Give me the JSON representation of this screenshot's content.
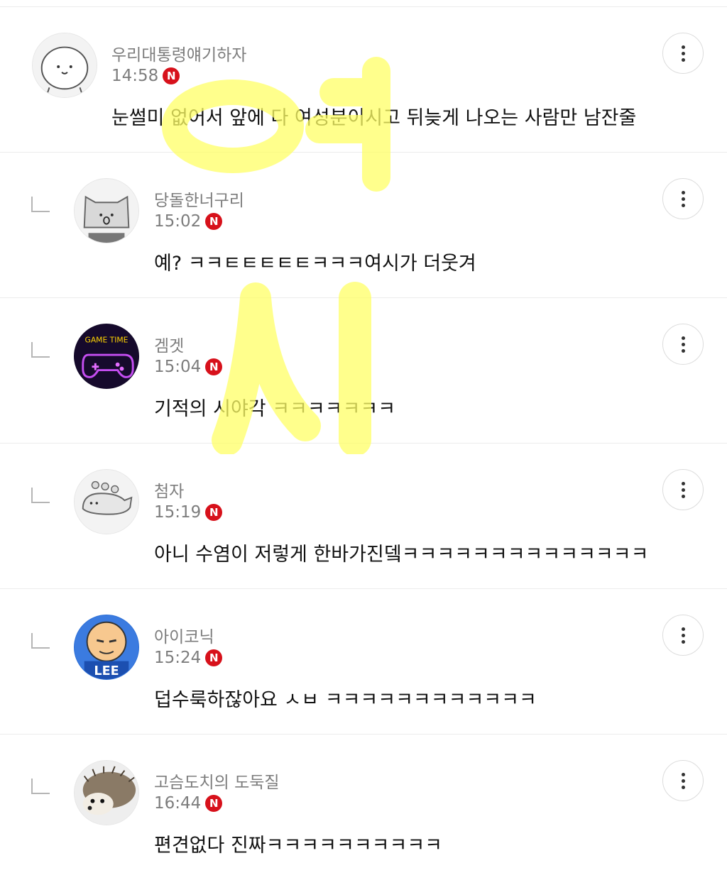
{
  "comments": [
    {
      "nickname": "우리대통령얘기하자",
      "time": "14:58",
      "badge": "N",
      "text": "눈썰미 없어서 앞에 다 여성분이시고 뒤늦게 나오는 사람만 남잔줄",
      "reply": false,
      "avatar_icon": "bear-avatar-icon"
    },
    {
      "nickname": "당돌한너구리",
      "time": "15:02",
      "badge": "N",
      "text": "예? ㅋㅋㅌㅌㅌㅌㅌㅋㅋㅋ여시가 더웃겨",
      "reply": true,
      "avatar_icon": "cat-avatar-icon"
    },
    {
      "nickname": "겜겟",
      "time": "15:04",
      "badge": "N",
      "text": "기적의 시야각 ㅋㅋㅋㅋㅋㅋㅋ",
      "reply": true,
      "avatar_icon": "game-controller-avatar-icon"
    },
    {
      "nickname": "첨자",
      "time": "15:19",
      "badge": "N",
      "text": "아니 수염이 저렇게 한바가진뎈ㅋㅋㅋㅋㅋㅋㅋㅋㅋㅋㅋㅋㅋㅋ",
      "reply": true,
      "avatar_icon": "dinosaur-avatar-icon"
    },
    {
      "nickname": "아이코닉",
      "time": "15:24",
      "badge": "N",
      "text": "덥수룩하잖아요 ㅅㅂ ㅋㅋㅋㅋㅋㅋㅋㅋㅋㅋㅋㅋ",
      "reply": true,
      "avatar_icon": "lee-cartoon-avatar-icon"
    },
    {
      "nickname": "고슴도치의 도둑질",
      "time": "16:44",
      "badge": "N",
      "text": "편견없다 진짜ㅋㅋㅋㅋㅋㅋㅋㅋㅋㅋ",
      "reply": true,
      "avatar_icon": "hedgehog-avatar-icon"
    }
  ],
  "avatar_game_text": "GAME TIME",
  "avatar_lee_text": "LEE",
  "watermark_text": "여시",
  "colors": {
    "badge": "#d7111b",
    "meta": "#7d7d7d",
    "watermark": "#ffff66"
  }
}
